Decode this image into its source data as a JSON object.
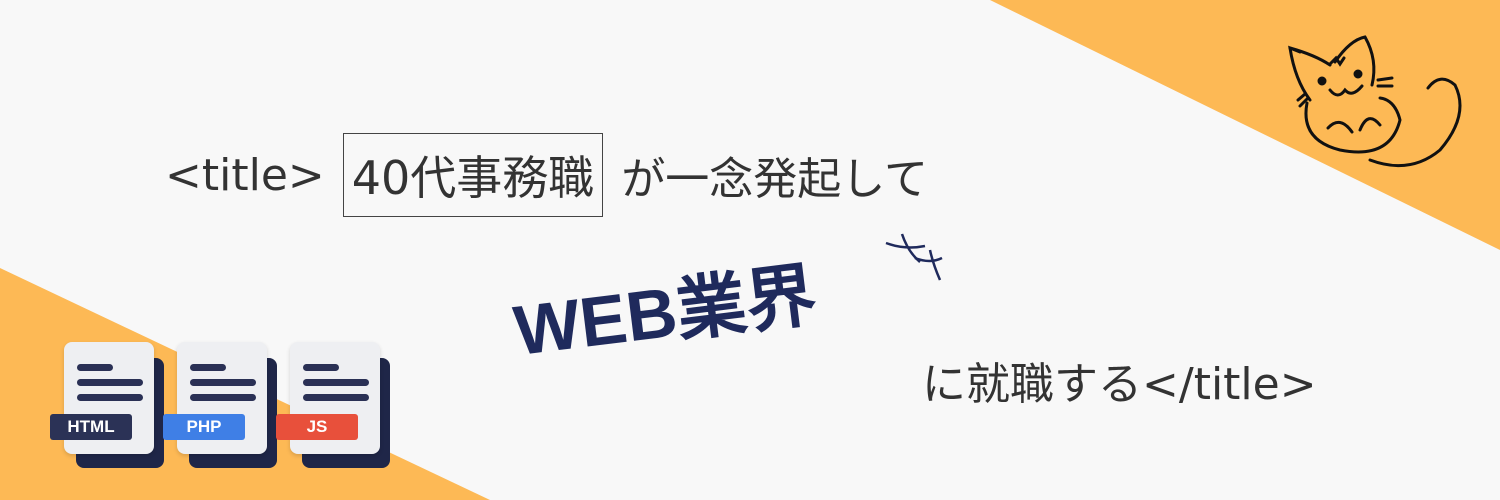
{
  "title_open": "<title>",
  "highlight": "40代事務職",
  "line1_rest": "が一念発起して",
  "headline": "WEB業界",
  "line3": "に就職する</title>",
  "file_badges": [
    {
      "label": "HTML",
      "color": "#2b3256"
    },
    {
      "label": "PHP",
      "color": "#3f7fe6"
    },
    {
      "label": "JS",
      "color": "#e8503b"
    }
  ],
  "colors": {
    "accent": "#fdb955",
    "background": "#f8f8f8",
    "navy": "#1f2a5c"
  }
}
